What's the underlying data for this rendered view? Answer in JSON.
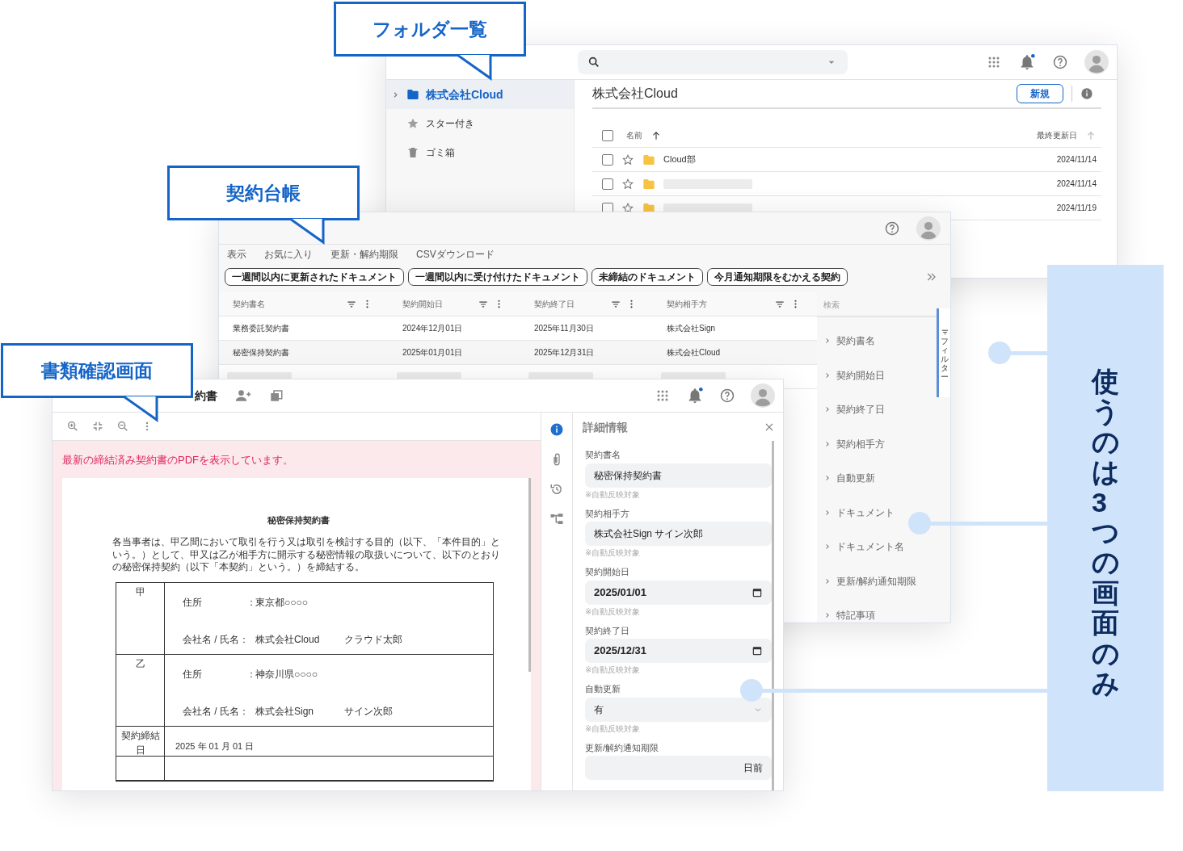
{
  "folder_window": {
    "sidebar": [
      {
        "label": "株式会社Cloud",
        "selected": true
      },
      {
        "label": "スター付き",
        "selected": false
      },
      {
        "label": "ゴミ箱",
        "selected": false
      }
    ],
    "title": "株式会社Cloud",
    "new_button": "新規",
    "columns": {
      "name": "名前",
      "updated": "最終更新日"
    },
    "header_checked": false,
    "rows": [
      {
        "kind": "named",
        "name": "Cloud部",
        "date": "2024/11/14",
        "checked": false,
        "starred": false
      },
      {
        "kind": "redacted",
        "date": "2024/11/14",
        "checked": false,
        "starred": false
      },
      {
        "kind": "redacted",
        "date": "2024/11/19",
        "checked": false,
        "starred": false
      }
    ]
  },
  "ledger_window": {
    "menu": [
      "表示",
      "お気に入り",
      "更新・解約期限",
      "CSVダウンロード"
    ],
    "quick_filters": [
      "一週間以内に更新されたドキュメント",
      "一週間以内に受け付けたドキュメント",
      "未締結のドキュメント",
      "今月通知期限をむかえる契約"
    ],
    "columns": [
      "契約書名",
      "契約開始日",
      "契約終了日",
      "契約相手方"
    ],
    "rows": [
      {
        "kind": "data",
        "cells": [
          "業務委託契約書",
          "2024年12月01日",
          "2025年11月30日",
          "株式会社Sign"
        ]
      },
      {
        "kind": "data",
        "cells": [
          "秘密保持契約書",
          "2025年01月01日",
          "2025年12月31日",
          "株式会社Cloud"
        ]
      },
      {
        "kind": "redacted",
        "cells": []
      }
    ],
    "filter_panel": {
      "search_label": "検索",
      "items": [
        "契約書名",
        "契約開始日",
        "契約終了日",
        "契約相手方",
        "自動更新",
        "ドキュメント",
        "ドキュメント名",
        "更新/解約通知期限",
        "特記事項"
      ],
      "tab_label": "フィルター"
    }
  },
  "document_window": {
    "title": "約書",
    "notice": "最新の締結済み契約書のPDFを表示しています。",
    "pdf": {
      "title": "秘密保持契約書",
      "paragraph": "各当事者は、甲乙間において取引を行う又は取引を検討する目的（以下、「本件目的」という。）として、甲又は乙が相手方に開示する秘密情報の取扱いについて、以下のとおりの秘密保持契約（以下「本契約」という。）を締結する。",
      "parties": [
        {
          "label": "甲",
          "address_label": "住所",
          "separator": "：",
          "address": "東京都○○○○",
          "name_label": "会社名 / 氏名：",
          "company": "株式会社Cloud",
          "person": "クラウド太郎"
        },
        {
          "label": "乙",
          "address_label": "住所",
          "separator": "：",
          "address": "神奈川県○○○○",
          "name_label": "会社名 / 氏名：",
          "company": "株式会社Sign",
          "person": "サイン次郎"
        }
      ],
      "signing": {
        "label": "契約締結日",
        "value": "2025 年 01 月 01 日"
      }
    },
    "details": {
      "title": "詳細情報",
      "fields": [
        {
          "kind": "text",
          "label": "契約書名",
          "value": "秘密保持契約書",
          "note": "※自動反映対象"
        },
        {
          "kind": "text",
          "label": "契約相手方",
          "value": "株式会社Sign サイン次郎",
          "note": "※自動反映対象"
        },
        {
          "kind": "date",
          "label": "契約開始日",
          "value": "2025/01/01",
          "note": "※自動反映対象"
        },
        {
          "kind": "date",
          "label": "契約終了日",
          "value": "2025/12/31",
          "note": "※自動反映対象"
        },
        {
          "kind": "select",
          "label": "自動更新",
          "value": "有",
          "note": "※自動反映対象"
        },
        {
          "kind": "suffix",
          "label": "更新/解約通知期限",
          "suffix": "日前"
        }
      ]
    }
  },
  "callouts": [
    {
      "text": "フォルダ一覧"
    },
    {
      "text": "契約台帳"
    },
    {
      "text": "書類確認画面"
    }
  ],
  "banner": {
    "text": "使うのは**3**つの画面のみ"
  }
}
